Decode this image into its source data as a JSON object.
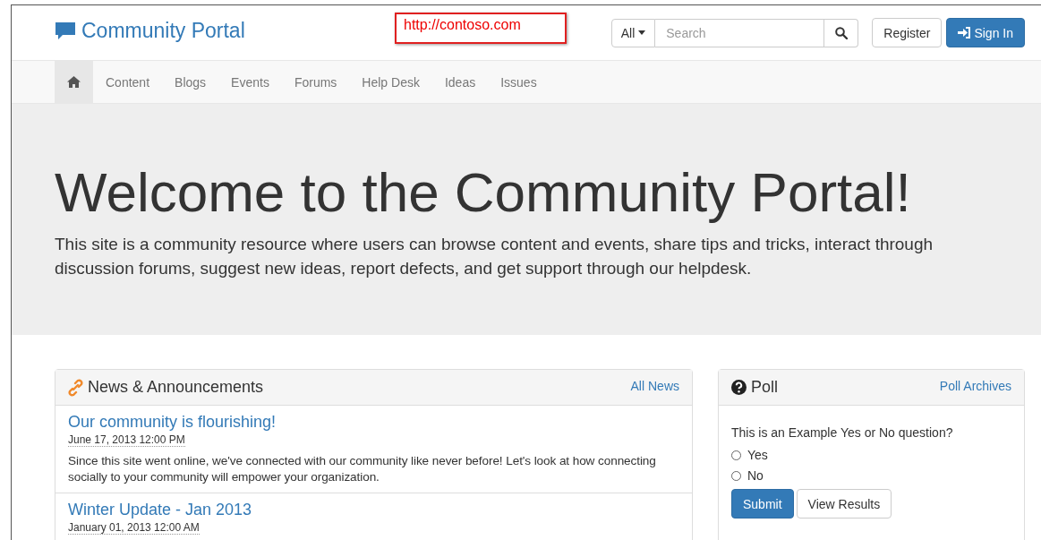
{
  "header": {
    "brand": "Community Portal",
    "url_callout": "http://contoso.com",
    "search": {
      "scope": "All",
      "placeholder": "Search"
    },
    "buttons": [
      {
        "label": "Register",
        "kind": "default"
      },
      {
        "label": "Sign In",
        "kind": "primary"
      }
    ]
  },
  "nav": {
    "items": [
      {
        "kind": "home",
        "selected": true
      },
      {
        "label": "Content",
        "kind": "link",
        "selected": false
      },
      {
        "label": "Blogs",
        "kind": "link",
        "selected": false
      },
      {
        "label": "Events",
        "kind": "link",
        "selected": false
      },
      {
        "label": "Forums",
        "kind": "link",
        "selected": false
      },
      {
        "label": "Help Desk",
        "kind": "link",
        "selected": false
      },
      {
        "label": "Ideas",
        "kind": "link",
        "selected": false
      },
      {
        "label": "Issues",
        "kind": "link",
        "selected": false
      }
    ]
  },
  "hero": {
    "title": "Welcome to the Community Portal!",
    "text": "This site is a community resource where users can browse content and events, share tips and tricks, interact through discussion forums, suggest new ideas, report defects, and get support through our helpdesk."
  },
  "news": {
    "title": "News & Announcements",
    "link": "All News",
    "items": [
      {
        "title": "Our community is flourishing!",
        "date": "June 17, 2013 12:00 PM",
        "summary": "Since this site went online, we've connected with our community like never before! Let's look at how connecting socially to your community will empower your organization."
      },
      {
        "title": "Winter Update - Jan 2013",
        "date": "January 01, 2013 12:00 AM"
      }
    ]
  },
  "poll": {
    "title": "Poll",
    "link": "Poll Archives",
    "question": "This is an Example Yes or No question?",
    "options": [
      {
        "label": "Yes",
        "selected": false
      },
      {
        "label": "No",
        "selected": false
      }
    ],
    "buttons": [
      {
        "label": "Submit",
        "kind": "primary"
      },
      {
        "label": "View Results",
        "kind": "default"
      }
    ]
  }
}
